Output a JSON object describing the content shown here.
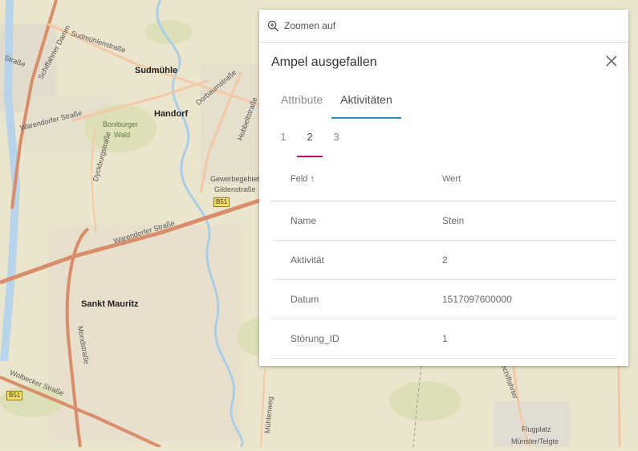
{
  "map": {
    "places": [
      "Sudmühle",
      "Handorf",
      "Sankt Mauritz"
    ],
    "forest": [
      "Boniburger",
      "Wald"
    ],
    "roads": [
      "Schiffahrter Damm",
      "Sudmühlenstraße",
      "Dorbaumstraße",
      "Hobbeltstraße",
      "Straße",
      "Warendorfer Straße",
      "Warendorfer Straße",
      "Dyckburgstraße",
      "Gildenstraße",
      "Mondstraße",
      "Wolbecker Straße",
      "Mühlenweg",
      "Schiffahrter"
    ],
    "area_labels": [
      "Gewerbegebiet",
      "Flugplatz",
      "Münster/Telgte"
    ],
    "shields": [
      "B51",
      "B51"
    ]
  },
  "popup": {
    "zoom_label": "Zoomen auf",
    "title": "Ampel ausgefallen",
    "tabs": [
      "Attribute",
      "Aktivitäten"
    ],
    "active_tab": "Aktivitäten",
    "pages": [
      "1",
      "2",
      "3"
    ],
    "active_page": "2",
    "table": {
      "headers": [
        "Feld",
        "Wert"
      ],
      "sort_indicator": "↑",
      "rows": [
        {
          "field": "Name",
          "value": "Stein"
        },
        {
          "field": "Aktivität",
          "value": "2"
        },
        {
          "field": "Datum",
          "value": "1517097600000"
        },
        {
          "field": "Störung_ID",
          "value": "1"
        }
      ]
    }
  }
}
